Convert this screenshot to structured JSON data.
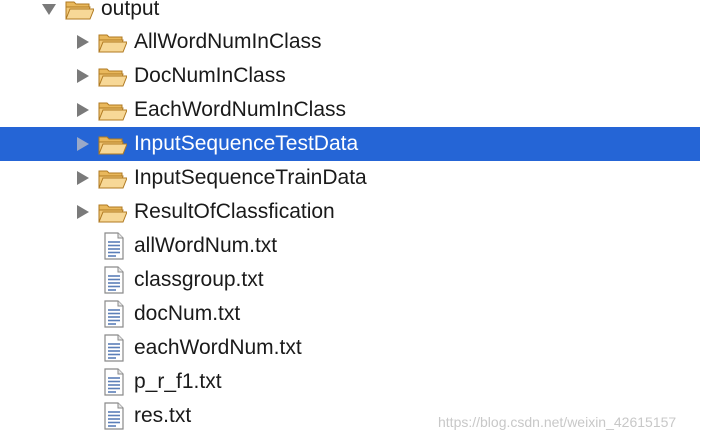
{
  "tree": {
    "root": {
      "label": "output",
      "expanded": true,
      "icon": "open-folder-icon"
    },
    "folders": [
      {
        "label": "AllWordNumInClass",
        "icon": "open-folder-icon",
        "expanded": false,
        "selected": false
      },
      {
        "label": "DocNumInClass",
        "icon": "open-folder-icon",
        "expanded": false,
        "selected": false
      },
      {
        "label": "EachWordNumInClass",
        "icon": "open-folder-icon",
        "expanded": false,
        "selected": false
      },
      {
        "label": "InputSequenceTestData",
        "icon": "open-folder-icon",
        "expanded": false,
        "selected": true
      },
      {
        "label": "InputSequenceTrainData",
        "icon": "open-folder-icon",
        "expanded": false,
        "selected": false
      },
      {
        "label": "ResultOfClassfication",
        "icon": "open-folder-icon",
        "expanded": false,
        "selected": false
      }
    ],
    "files": [
      {
        "label": "allWordNum.txt",
        "icon": "text-file-icon"
      },
      {
        "label": "classgroup.txt",
        "icon": "text-file-icon"
      },
      {
        "label": "docNum.txt",
        "icon": "text-file-icon"
      },
      {
        "label": "eachWordNum.txt",
        "icon": "text-file-icon"
      },
      {
        "label": "p_r_f1.txt",
        "icon": "text-file-icon"
      },
      {
        "label": "res.txt",
        "icon": "text-file-icon"
      }
    ]
  },
  "watermark": "https://blog.csdn.net/weixin_42615157",
  "colors": {
    "selection": "#2565d6",
    "folder_fill": "#f2c877",
    "folder_stroke": "#b07a22",
    "twisty": "#7a7a7a",
    "file_line": "#5b7fb8"
  }
}
